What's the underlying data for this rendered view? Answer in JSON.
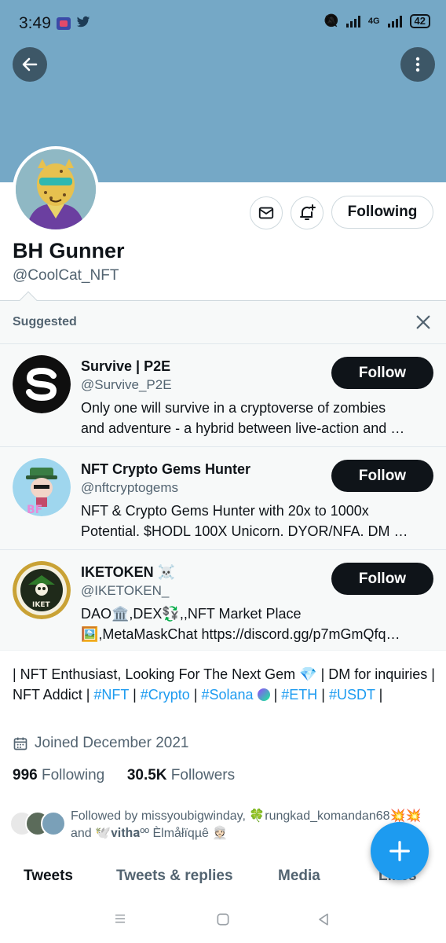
{
  "status_bar": {
    "time": "3:49",
    "network": "4G",
    "battery": "42"
  },
  "profile": {
    "display_name": "BH Gunner",
    "handle": "@CoolCat_NFT",
    "following_button": "Following"
  },
  "suggested": {
    "title": "Suggested",
    "cards": [
      {
        "name": "Survive | P2E",
        "handle": "@Survive_P2E",
        "bio_line1": "Only one will survive in a cryptoverse of zombies",
        "bio_line2": "and adventure - a hybrid between live-action and …",
        "button": "Follow"
      },
      {
        "name": "NFT Crypto Gems Hunter",
        "handle": "@nftcryptogems",
        "bio_line1": "NFT & Crypto Gems Hunter with 20x to 1000x",
        "bio_line2": "Potential. $HODL 100X Unicorn. DYOR/NFA. DM …",
        "button": "Follow"
      },
      {
        "name": "IKETOKEN ☠️",
        "handle": "@IKETOKEN_",
        "bio_line1": "DAO🏛️,DEX💱,,NFT Market Place",
        "bio_line2": "🖼️,MetaMaskChat https://discord.gg/p7mGmQfq…",
        "button": "Follow"
      }
    ]
  },
  "bio": {
    "part1": "| NFT Enthusiast, Looking For The Next Gem ",
    "gem": "💎",
    "part2": " | DM for inquiries | NFT Addict | ",
    "tag_nft": "#NFT",
    "sep1": " | ",
    "tag_crypto": "#Crypto",
    "sep2": " | ",
    "tag_solana": "#Solana",
    "sep3": " | ",
    "tag_eth": "#ETH",
    "sep4": " | ",
    "tag_usdt": "#USDT",
    "sep5": " |"
  },
  "joined": "Joined December 2021",
  "counts": {
    "following_num": "996",
    "following_label": "Following",
    "followers_num": "30.5K",
    "followers_label": "Followers"
  },
  "followed_by": "Followed by missyoubigwinday, 🍀rungkad_komandan68💥💥 and 🕊️𝐯𝐢𝐭𝐡𝐚ºº Èlmåłïqµê 👳🏻",
  "tabs": [
    "Tweets",
    "Tweets & replies",
    "Media",
    "Likes"
  ],
  "colors": {
    "banner": "#75a8c6",
    "accent": "#1d9bf0",
    "dark_button": "#0f1419"
  },
  "icons": [
    "back-arrow-icon",
    "more-vertical-icon",
    "mail-icon",
    "bell-plus-icon",
    "close-icon",
    "calendar-icon",
    "compose-plus-icon"
  ]
}
